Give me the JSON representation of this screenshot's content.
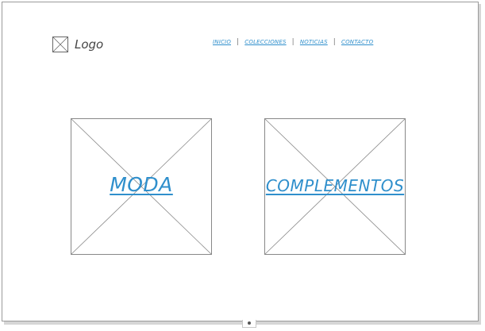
{
  "header": {
    "logo_label": "Logo",
    "logo_icon": "image-placeholder-icon"
  },
  "nav": {
    "items": [
      {
        "label": "INICIO"
      },
      {
        "label": "COLECCIONES"
      },
      {
        "label": "NOTICIAS"
      },
      {
        "label": "CONTACTO"
      }
    ],
    "separator": "|"
  },
  "tiles": [
    {
      "label": "MODA",
      "icon": "image-placeholder-icon"
    },
    {
      "label": "COMPLEMENTOS",
      "icon": "image-placeholder-icon"
    }
  ],
  "colors": {
    "link": "#2f8fcc",
    "placeholder_line": "#888888"
  }
}
